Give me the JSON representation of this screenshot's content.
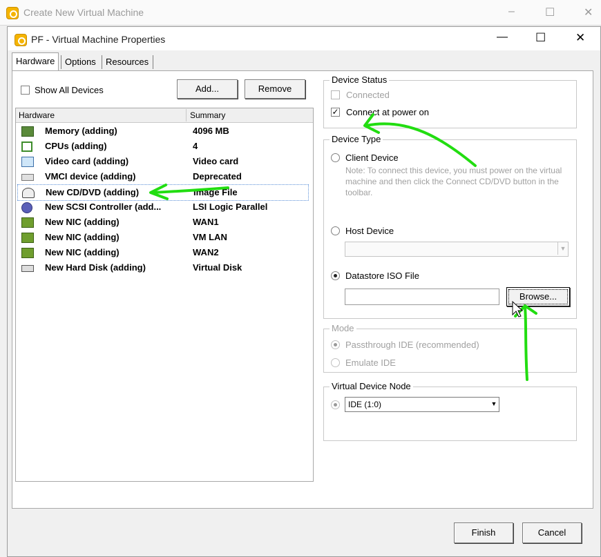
{
  "outer_window": {
    "title": "Create New Virtual Machine",
    "controls": {
      "minimize": "–",
      "maximize": "☐",
      "close": "✕"
    }
  },
  "dialog": {
    "title": "PF - Virtual Machine Properties",
    "controls": {
      "minimize": "—",
      "maximize": "☐",
      "close": "✕"
    }
  },
  "tabs": [
    {
      "label": "Hardware",
      "active": true
    },
    {
      "label": "Options",
      "active": false
    },
    {
      "label": "Resources",
      "active": false
    }
  ],
  "hardware_panel": {
    "show_all_devices_label": "Show All Devices",
    "show_all_devices_checked": false,
    "add_label": "Add...",
    "remove_label": "Remove",
    "columns": [
      "Hardware",
      "Summary"
    ],
    "rows": [
      {
        "icon": "memory-icon",
        "name": "Memory (adding)",
        "summary": "4096 MB"
      },
      {
        "icon": "cpu-icon",
        "name": "CPUs (adding)",
        "summary": "4"
      },
      {
        "icon": "video-card-icon",
        "name": "Video card  (adding)",
        "summary": "Video card"
      },
      {
        "icon": "vmci-icon",
        "name": "VMCI device (adding)",
        "summary": "Deprecated"
      },
      {
        "icon": "cd-dvd-icon",
        "name": "New CD/DVD (adding)",
        "summary": "Image File",
        "selected": true
      },
      {
        "icon": "scsi-controller-icon",
        "name": "New SCSI Controller (add...",
        "summary": "LSI Logic Parallel"
      },
      {
        "icon": "nic-icon",
        "name": "New NIC (adding)",
        "summary": "WAN1"
      },
      {
        "icon": "nic-icon",
        "name": "New NIC (adding)",
        "summary": "VM LAN"
      },
      {
        "icon": "nic-icon",
        "name": "New NIC (adding)",
        "summary": "WAN2"
      },
      {
        "icon": "hard-disk-icon",
        "name": "New Hard Disk (adding)",
        "summary": "Virtual Disk"
      }
    ]
  },
  "device_status": {
    "label": "Device Status",
    "connected_label": "Connected",
    "connected_checked": false,
    "connect_at_power_on_label": "Connect at power on",
    "connect_at_power_on_checked": true
  },
  "device_type": {
    "label": "Device Type",
    "client_device_label": "Client Device",
    "client_note": "Note: To connect this device, you must power on the virtual machine and then click the Connect CD/DVD button in the toolbar.",
    "host_device_label": "Host Device",
    "host_device_value": "",
    "datastore_iso_label": "Datastore ISO File",
    "datastore_iso_value": "",
    "browse_label": "Browse...",
    "selected": "Datastore ISO File"
  },
  "mode": {
    "label": "Mode",
    "passthrough_label": "Passthrough IDE (recommended)",
    "emulate_label": "Emulate IDE"
  },
  "virtual_device_node": {
    "label": "Virtual Device Node",
    "value": "IDE (1:0)"
  },
  "footer": {
    "finish_label": "Finish",
    "cancel_label": "Cancel"
  },
  "annotation_color": "#22dd11"
}
